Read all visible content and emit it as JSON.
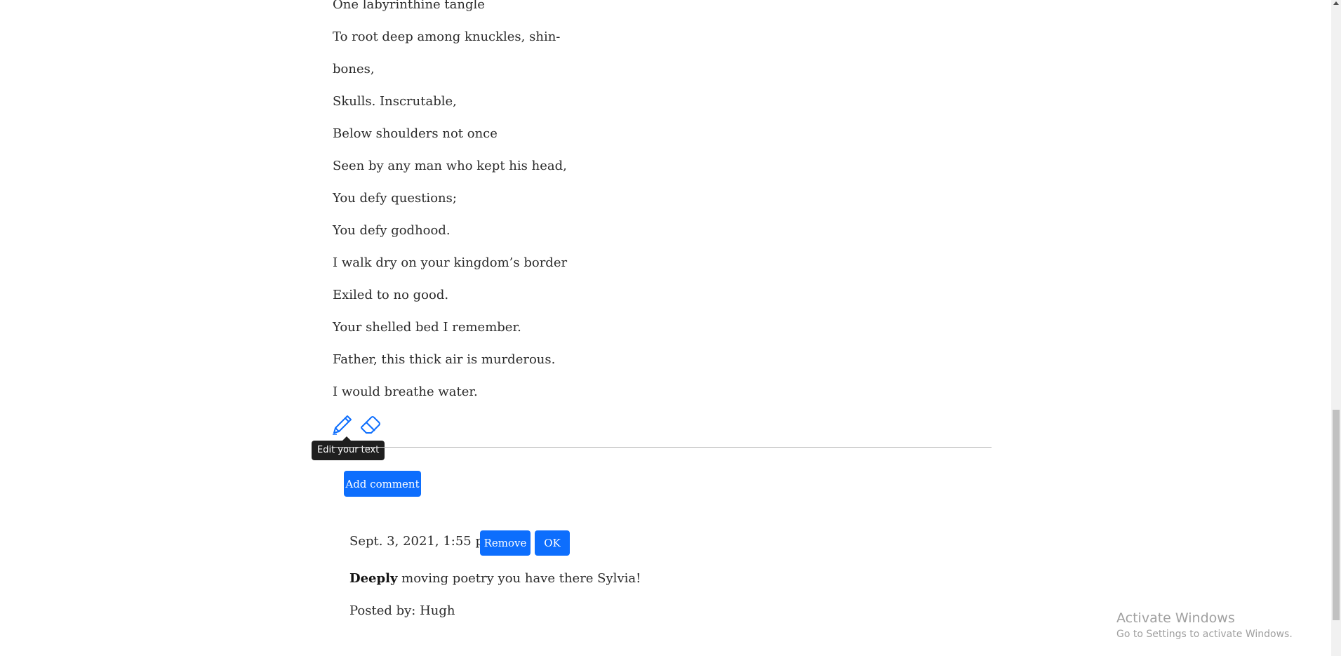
{
  "poem": {
    "lines": [
      "One labyrinthine tangle",
      "To root deep among knuckles, shin-",
      "bones,",
      "Skulls. Inscrutable,",
      "Below shoulders not once",
      "Seen by any man who kept his head,",
      "You defy questions;",
      "You defy godhood.",
      "I walk dry on your kingdom’s border",
      "Exiled to no good.",
      "Your shelled bed I remember.",
      "Father, this thick air is murderous.",
      "I would breathe water."
    ]
  },
  "toolbar": {
    "edit_tooltip": "Edit your text"
  },
  "comments": {
    "add_label": "Add comment",
    "items": [
      {
        "date": "Sept. 3, 2021, 1:55 p.m.",
        "remove_label": "Remove",
        "ok_label": "OK",
        "body_bold": "Deeply",
        "body_rest": " moving poetry you have there Sylvia!",
        "posted_by": "Posted by: Hugh"
      }
    ]
  },
  "watermark": {
    "title": "Activate Windows",
    "subtitle": "Go to Settings to activate Windows."
  },
  "colors": {
    "primary": "#0d6efd",
    "tooltip_bg": "#1f1f1f"
  },
  "icons": {
    "edit": "pencil-icon",
    "erase": "eraser-icon"
  }
}
